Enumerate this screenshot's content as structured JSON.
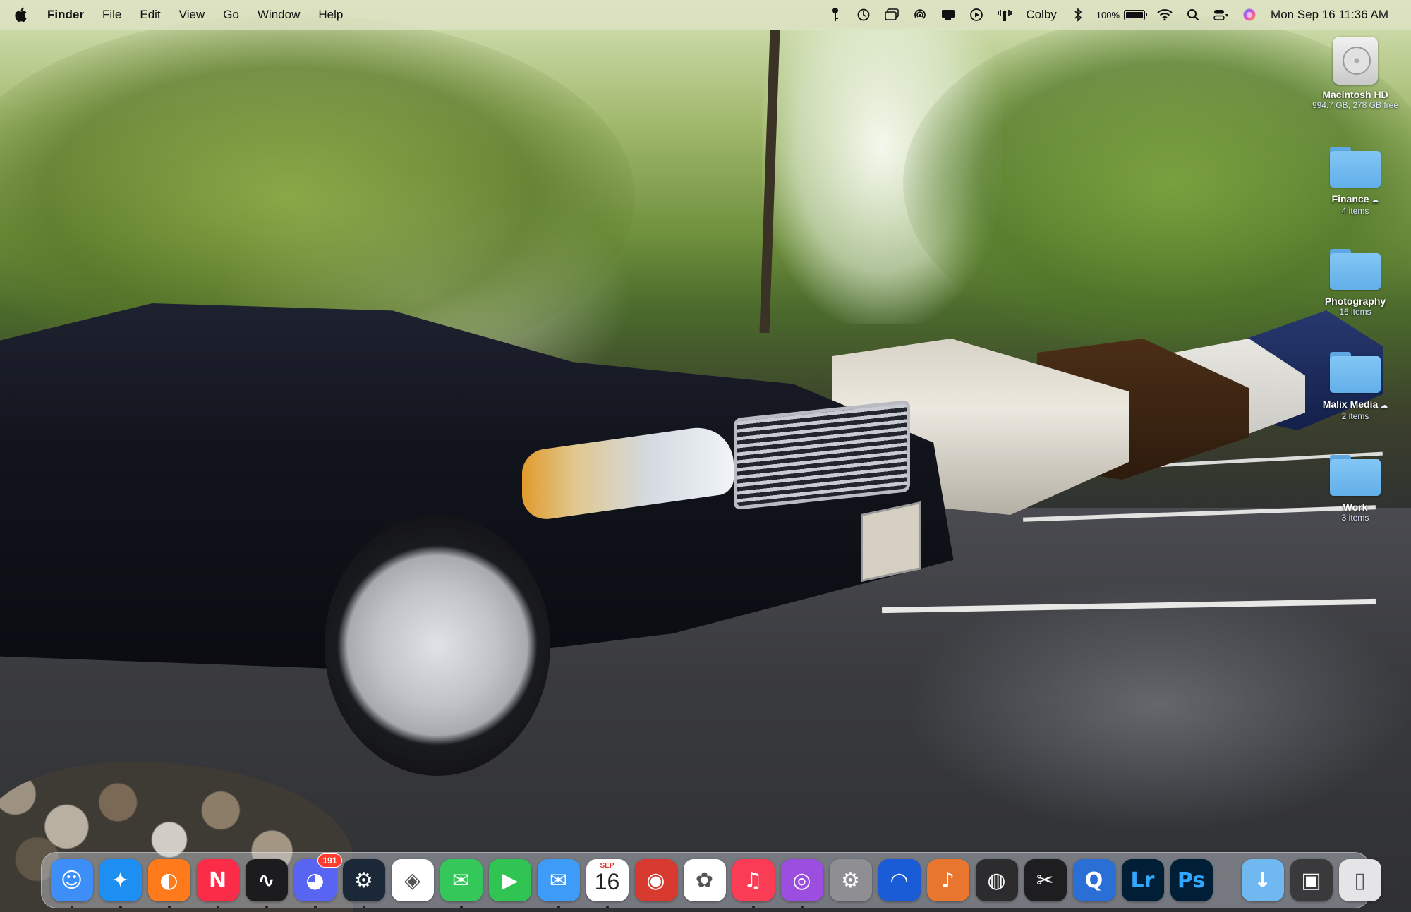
{
  "menubar": {
    "app_name": "Finder",
    "menus": [
      "File",
      "Edit",
      "View",
      "Go",
      "Window",
      "Help"
    ],
    "user_name": "Colby",
    "battery_percent": "100%",
    "battery_level": 1.0,
    "datetime": "Mon Sep 16  11:36 AM",
    "status_icons": [
      "key-icon",
      "time-machine-icon",
      "window-icon",
      "airdrop-icon",
      "display-icon",
      "play-icon",
      "hotspot-icon",
      "bluetooth-icon",
      "wifi-icon",
      "search-icon",
      "control-center-icon",
      "siri-icon"
    ]
  },
  "desktop_icons": [
    {
      "name": "Macintosh HD",
      "detail": "994.7 GB, 278 GB free",
      "kind": "drive"
    },
    {
      "name": "Finance",
      "detail": "4 items",
      "kind": "folder",
      "cloud": true
    },
    {
      "name": "Photography",
      "detail": "16 items",
      "kind": "folder",
      "cloud": false
    },
    {
      "name": "Malix Media",
      "detail": "2 items",
      "kind": "folder",
      "cloud": true
    },
    {
      "name": "Work",
      "detail": "3 items",
      "kind": "folder",
      "cloud": false
    }
  ],
  "dock": {
    "apps": [
      {
        "name": "Finder",
        "icon": "finder-icon",
        "color": "#3e8ef7",
        "running": true
      },
      {
        "name": "Safari",
        "icon": "safari-icon",
        "color": "#1d8ff2",
        "running": true
      },
      {
        "name": "Firefox",
        "icon": "firefox-icon",
        "color": "#ff7a1a",
        "running": true
      },
      {
        "name": "News",
        "icon": "news-icon",
        "color": "#fa2c48",
        "running": true
      },
      {
        "name": "Stocks",
        "icon": "stocks-icon",
        "color": "#1c1c1e",
        "running": true
      },
      {
        "name": "Discord",
        "icon": "discord-icon",
        "color": "#5865f2",
        "running": true,
        "badge": "191"
      },
      {
        "name": "Steam",
        "icon": "steam-icon",
        "color": "#1b2838",
        "running": true
      },
      {
        "name": "Perplexity",
        "icon": "perplexity-icon",
        "color": "#ffffff",
        "running": false
      },
      {
        "name": "Messages",
        "icon": "messages-icon",
        "color": "#34c759",
        "running": true
      },
      {
        "name": "FaceTime",
        "icon": "facetime-icon",
        "color": "#30c452",
        "running": false
      },
      {
        "name": "Mail",
        "icon": "mail-icon",
        "color": "#3e9bf7",
        "running": true
      },
      {
        "name": "Calendar",
        "icon": "calendar-icon",
        "color": "#ffffff",
        "running": true,
        "month": "SEP",
        "day": "16"
      },
      {
        "name": "Photo Booth",
        "icon": "photo-booth-icon",
        "color": "#d93a2f",
        "running": false
      },
      {
        "name": "Photos",
        "icon": "photos-icon",
        "color": "#ffffff",
        "running": false
      },
      {
        "name": "Music",
        "icon": "music-icon",
        "color": "#fa3c55",
        "running": true
      },
      {
        "name": "Podcasts",
        "icon": "podcasts-icon",
        "color": "#9b4ee0",
        "running": true
      },
      {
        "name": "System Settings",
        "icon": "system-settings-icon",
        "color": "#8e8e93",
        "running": false
      },
      {
        "name": "Audacity",
        "icon": "audacity-icon",
        "color": "#1a5cd6",
        "running": false
      },
      {
        "name": "GarageBand",
        "icon": "garageband-icon",
        "color": "#e8762e",
        "running": false
      },
      {
        "name": "Compressor",
        "icon": "compressor-icon",
        "color": "#2c2c2e",
        "running": false
      },
      {
        "name": "Final Cut Pro",
        "icon": "final-cut-pro-icon",
        "color": "#1e1e20",
        "running": false
      },
      {
        "name": "QuickTime Player",
        "icon": "quicktime-icon",
        "color": "#2a6fd6",
        "running": false
      },
      {
        "name": "Lightroom",
        "icon": "lightroom-icon",
        "color": "#001e36",
        "running": false,
        "label": "Lr"
      },
      {
        "name": "Photoshop",
        "icon": "photoshop-icon",
        "color": "#001e36",
        "running": false,
        "label": "Ps"
      }
    ],
    "stack": [
      {
        "name": "Downloads",
        "icon": "downloads-folder-icon",
        "color": "#6fb8f0"
      },
      {
        "name": "Screenshot",
        "icon": "screenshot-thumbnail-icon",
        "color": "#3a3a3c"
      },
      {
        "name": "Trash",
        "icon": "trash-icon",
        "color": "#e5e5e7"
      }
    ]
  }
}
